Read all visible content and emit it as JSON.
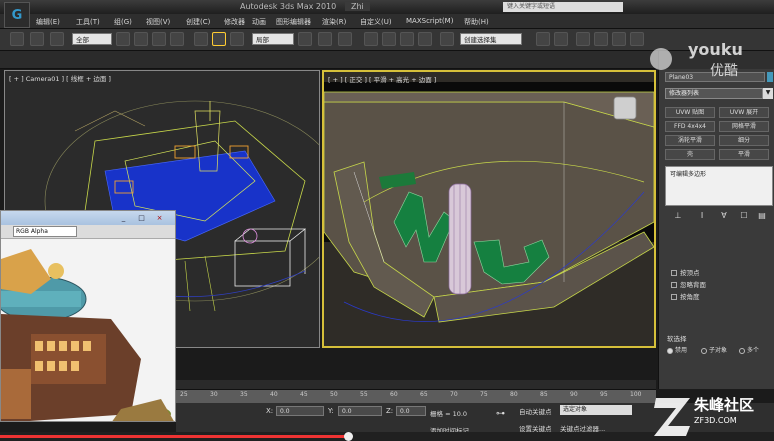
{
  "window": {
    "app_title": "Autodesk 3ds Max 2010",
    "file_tab": "Zhi",
    "search_placeholder": "键入关键字或短语"
  },
  "menu": {
    "items": [
      "编辑(E)",
      "工具(T)",
      "组(G)",
      "视图(V)",
      "创建(C)",
      "修改器",
      "动画",
      "图形编辑器",
      "渲染(R)",
      "自定义(U)",
      "MAXScript(M)",
      "帮助(H)"
    ]
  },
  "toolbar": {
    "selection_filter": "全部",
    "reference_coord": "局部",
    "named_selection": "创建选择集"
  },
  "viewports": {
    "left_label": "[ + ] Camera01 ] [ 线框 + 边面 ]",
    "right_label": "[ + ] [ 正交 ] [ 平滑 + 高光 + 边面 ]"
  },
  "render_window": {
    "channel": "RGB Alpha",
    "controls": [
      "_",
      "□",
      "×"
    ]
  },
  "command_panel": {
    "object_name": "Plane03",
    "modifier_list": "修改器列表",
    "modifier_buttons": [
      "UVW 贴图",
      "UVW 展开",
      "FFD 4x4x4",
      "网格平滑",
      "涡轮平滑",
      "细分",
      "壳",
      "平滑"
    ],
    "stack_item": "可编辑多边形",
    "checkboxes": [
      "按顶点",
      "忽略背面",
      "按角度"
    ],
    "soft_selection": "软选择",
    "radio_options": [
      "禁用",
      "子对象",
      "多个"
    ]
  },
  "timeline": {
    "ticks": [
      "25",
      "30",
      "35",
      "40",
      "45",
      "50",
      "55",
      "60",
      "65",
      "70",
      "75",
      "80",
      "85",
      "90",
      "95",
      "100"
    ]
  },
  "status": {
    "x_label": "X:",
    "x_value": "0.0",
    "y_label": "Y:",
    "y_value": "0.0",
    "z_label": "Z:",
    "z_value": "0.0",
    "grid": "栅格 = 10.0",
    "add_time_tag": "添加时间标记",
    "auto_key": "自动关键点",
    "key_mode": "选定对象",
    "set_key": "设置关键点",
    "key_filters": "关键点过滤器..."
  },
  "playback": {
    "progress": 0.45
  },
  "watermarks": {
    "youku": "youku",
    "youku_cn": "优酷",
    "site_name": "朱峰社区",
    "site_url": "ZF3D.COM"
  }
}
